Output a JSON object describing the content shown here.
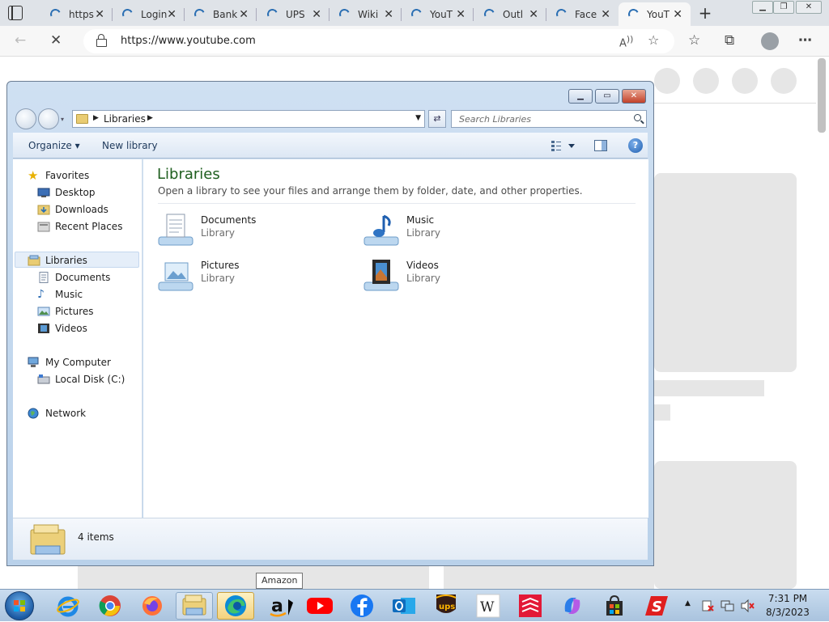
{
  "browser": {
    "tabs": [
      {
        "label": "https"
      },
      {
        "label": "Login"
      },
      {
        "label": "Bank"
      },
      {
        "label": "UPS"
      },
      {
        "label": "Wiki"
      },
      {
        "label": "YouT"
      },
      {
        "label": "Outl"
      },
      {
        "label": "Face"
      },
      {
        "label": "YouT"
      }
    ],
    "active_tab": 8,
    "url": "https://www.youtube.com"
  },
  "explorer": {
    "breadcrumb": "Libraries",
    "search_placeholder": "Search Libraries",
    "toolbar": {
      "organize": "Organize",
      "new_library": "New library"
    },
    "nav": {
      "favorites": "Favorites",
      "desktop": "Desktop",
      "downloads": "Downloads",
      "recent": "Recent Places",
      "libraries": "Libraries",
      "documents": "Documents",
      "music": "Music",
      "pictures": "Pictures",
      "videos": "Videos",
      "computer": "My Computer",
      "local_disk": "Local Disk (C:)",
      "network": "Network"
    },
    "content": {
      "title": "Libraries",
      "description": "Open a library to see your files and arrange them by folder, date, and other properties.",
      "items": [
        {
          "name": "Documents",
          "type": "Library"
        },
        {
          "name": "Music",
          "type": "Library"
        },
        {
          "name": "Pictures",
          "type": "Library"
        },
        {
          "name": "Videos",
          "type": "Library"
        }
      ]
    },
    "status": "4 items"
  },
  "tooltip": "Amazon",
  "taskbar": {
    "time": "7:31 PM",
    "date": "8/3/2023"
  },
  "colors": {
    "library_title": "#1e5e1e",
    "explorer_frame": "#b9d1ea",
    "taskbar": "#a9c3de"
  }
}
